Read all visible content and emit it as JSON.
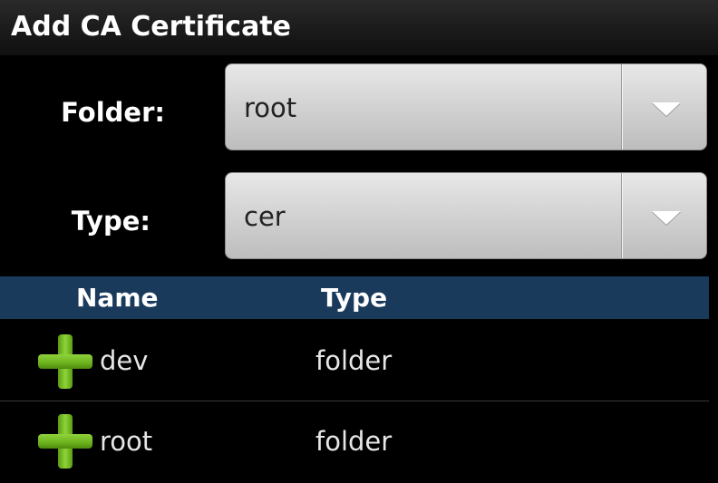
{
  "dialog": {
    "title": "Add CA Certificate"
  },
  "form": {
    "folder_label": "Folder:",
    "folder_value": "root",
    "type_label": "Type:",
    "type_value": "cer"
  },
  "table": {
    "columns": [
      "Name",
      "Type"
    ],
    "rows": [
      {
        "name": "dev",
        "type": "folder",
        "icon": "plus-icon"
      },
      {
        "name": "root",
        "type": "folder",
        "icon": "plus-icon"
      }
    ]
  },
  "colors": {
    "header_bg": "#1a3a5c",
    "icon_green": "#6cb21e"
  }
}
